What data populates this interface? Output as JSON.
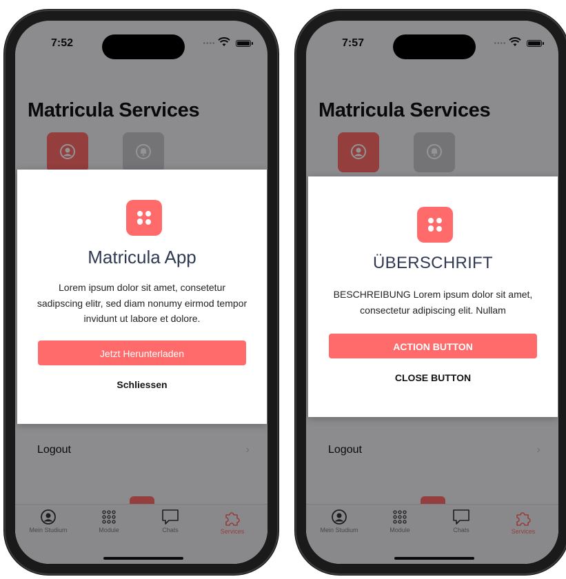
{
  "colors": {
    "accent": "#ff6b6b",
    "title_navy": "#2f3a52",
    "tab_inactive": "#7d7d80"
  },
  "screens": [
    {
      "status_time": "7:52",
      "title": "Matricula Services",
      "logout": "Logout",
      "tabs": [
        "Mein Studium",
        "Module",
        "Chats",
        "Services"
      ],
      "active_tab": "Services",
      "modal": {
        "title": "Matricula App",
        "description": "Lorem ipsum dolor sit amet, consetetur sadipscing elitr, sed diam nonumy eirmod tempor invidunt ut labore et dolore.",
        "action_label": "Jetzt Herunterladen",
        "close_label": "Schliessen"
      }
    },
    {
      "status_time": "7:57",
      "title": "Matricula Services",
      "logout": "Logout",
      "tabs": [
        "Mein Studium",
        "Module",
        "Chats",
        "Services"
      ],
      "active_tab": "Services",
      "modal": {
        "title": "ÜBERSCHRIFT",
        "description": "BESCHREIBUNG Lorem ipsum dolor sit amet, consectetur adipiscing elit. Nullam",
        "action_label": "ACTION BUTTON",
        "close_label": "CLOSE BUTTON"
      }
    }
  ],
  "icons": {
    "tile_profile": "user-circle-icon",
    "tile_bell": "bell-icon",
    "app_logo": "matricula-logo-icon",
    "tab_icons": [
      "user-circle-icon",
      "grid-dots-icon",
      "chat-bubble-icon",
      "puzzle-icon"
    ]
  }
}
